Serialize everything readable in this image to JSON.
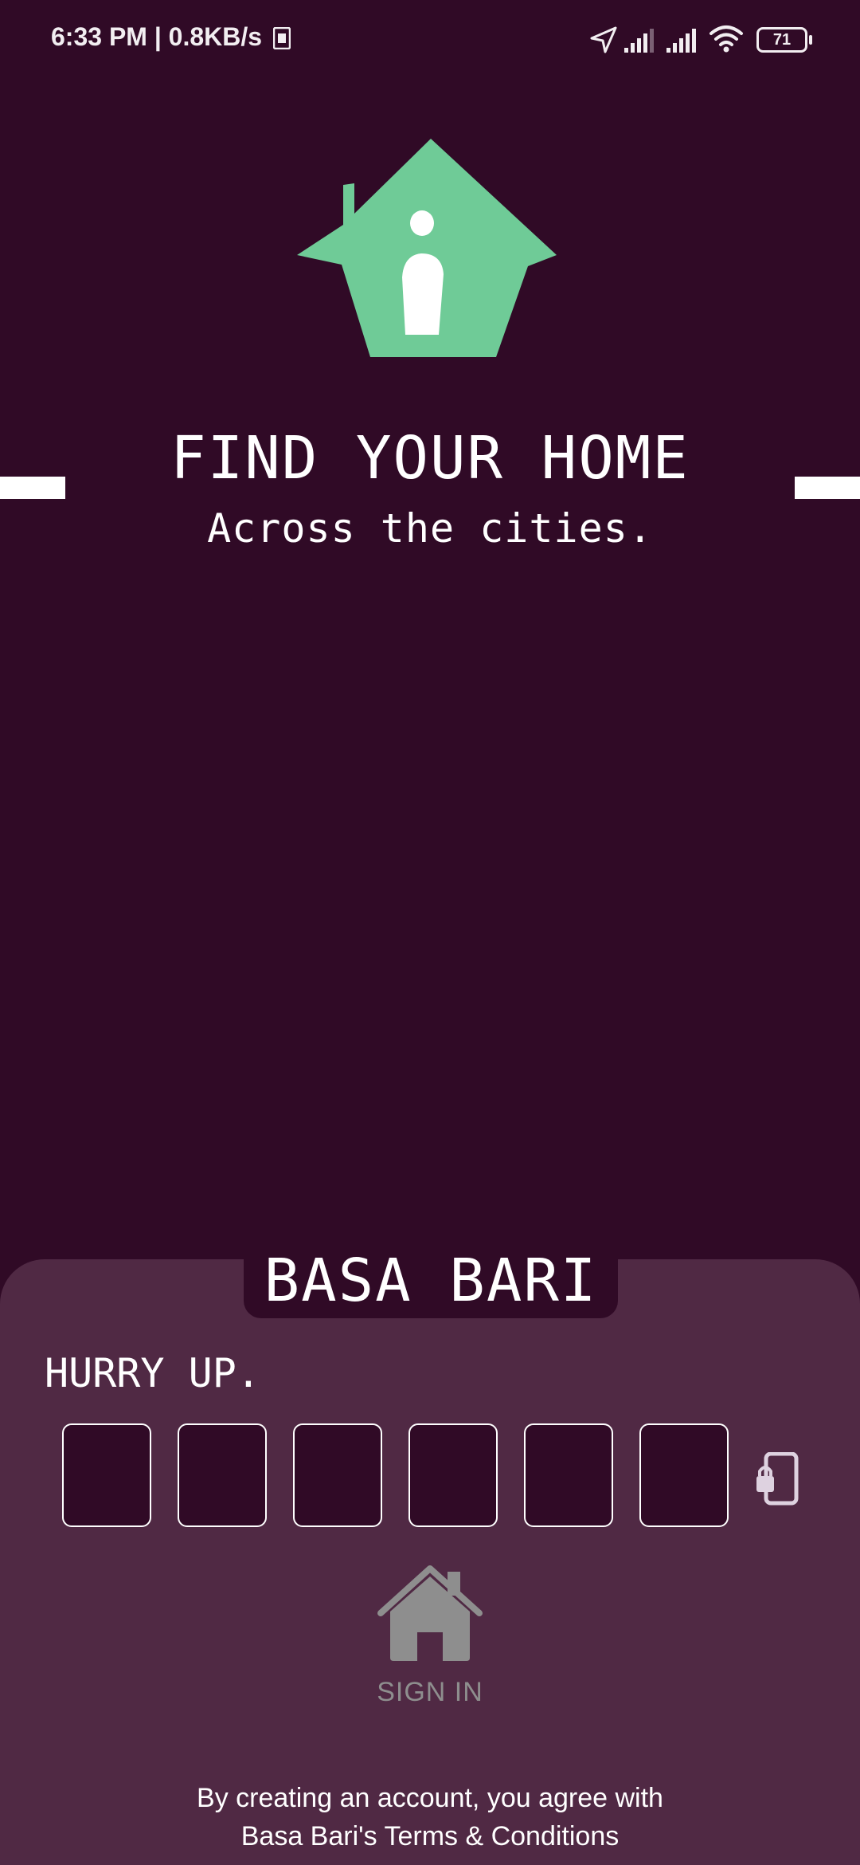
{
  "status_bar": {
    "time_speed": "6:33 PM | 0.8KB/s",
    "battery": "71",
    "icons": [
      "sim-card-icon",
      "location-arrow-icon",
      "signal-1-icon",
      "signal-2-icon",
      "wifi-icon",
      "battery-icon"
    ]
  },
  "hero": {
    "title": "FIND YOUR HOME",
    "subtitle": "Across the cities.",
    "house_color": "#6fcb97"
  },
  "sheet": {
    "brand": "BASA BARI",
    "prompt": "HURRY UP.",
    "otp_boxes": [
      "",
      "",
      "",
      "",
      "",
      ""
    ],
    "sign_in_label": "SIGN IN",
    "terms_line1": "By creating an account, you agree with",
    "terms_line2": "Basa Bari's Terms & Conditions"
  },
  "colors": {
    "background": "#300a26",
    "sheet": "#502944",
    "accent": "#6fcb97",
    "disabled": "#8e8e8e"
  }
}
